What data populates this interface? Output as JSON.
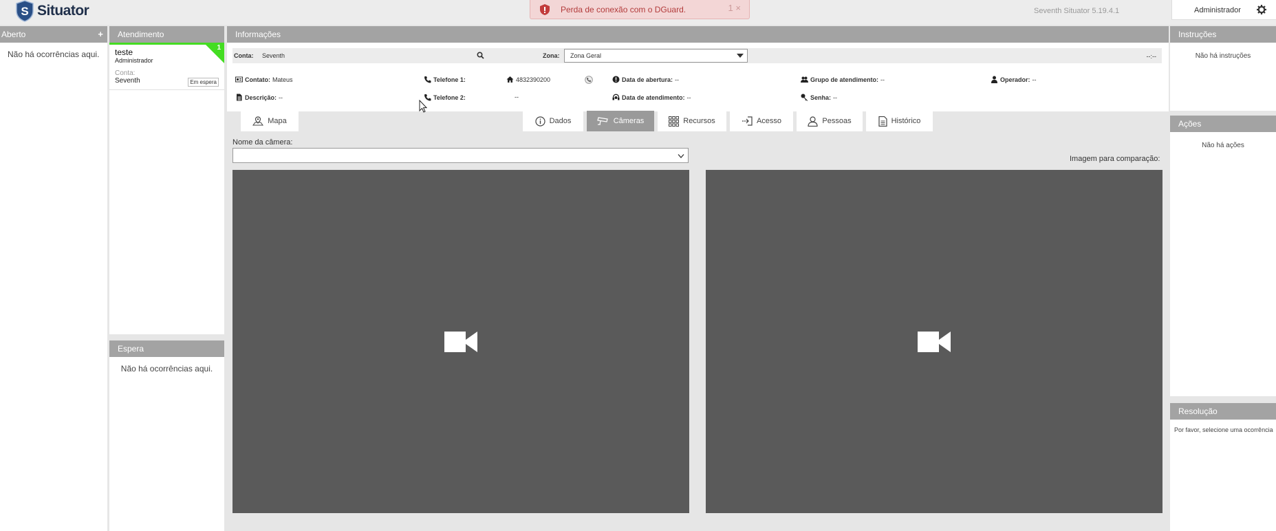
{
  "app": {
    "name": "Situator",
    "version": "Seventh Situator 5.19.4.1",
    "user": "Administrador"
  },
  "alert": {
    "message": "Perda de conexão com o DGuard.",
    "count": "1",
    "close": "×"
  },
  "aberto": {
    "title": "Aberto",
    "add": "+",
    "empty": "Não há ocorrências aqui."
  },
  "atendimento": {
    "title": "Atendimento",
    "card": {
      "title": "teste",
      "subtitle": "Administrador",
      "conta_label": "Conta:",
      "conta": "Seventh",
      "status": "Em espera",
      "badge": "1"
    }
  },
  "espera": {
    "title": "Espera",
    "empty": "Não há ocorrências aqui."
  },
  "info": {
    "title": "Informações",
    "conta_label": "Conta:",
    "conta": "Seventh",
    "zona_label": "Zona:",
    "zona": "Zona Geral",
    "time": "--:--",
    "contato_label": "Contato:",
    "contato": "Mateus",
    "tel1_label": "Telefone 1:",
    "tel1": "4832390200",
    "abertura_label": "Data de abertura:",
    "abertura": "--",
    "grupo_label": "Grupo de atendimento:",
    "grupo": "--",
    "operador_label": "Operador:",
    "operador": "--",
    "descricao_label": "Descrição:",
    "descricao": "--",
    "tel2_label": "Telefone 2:",
    "tel2": "--",
    "atendimento_label": "Data de atendimento:",
    "atendimento": "--",
    "senha_label": "Senha:",
    "senha": "--"
  },
  "tabs": {
    "mapa": "Mapa",
    "dados": "Dados",
    "cameras": "Câmeras",
    "recursos": "Recursos",
    "acesso": "Acesso",
    "pessoas": "Pessoas",
    "historico": "Histórico"
  },
  "camera": {
    "name_label": "Nome da câmera:",
    "compare_label": "Imagem para comparação:",
    "selected": ""
  },
  "instrucoes": {
    "title": "Instruções",
    "empty": "Não há instruções"
  },
  "acoes": {
    "title": "Ações",
    "empty": "Não há ações"
  },
  "resolucao": {
    "title": "Resolução",
    "text": "Por favor, selecione uma ocorrência"
  },
  "colors": {
    "header_gray": "#a3a3a3",
    "accent_green": "#44dd22",
    "alert_red": "#b23b3b",
    "video_bg": "#5a5a5a"
  }
}
